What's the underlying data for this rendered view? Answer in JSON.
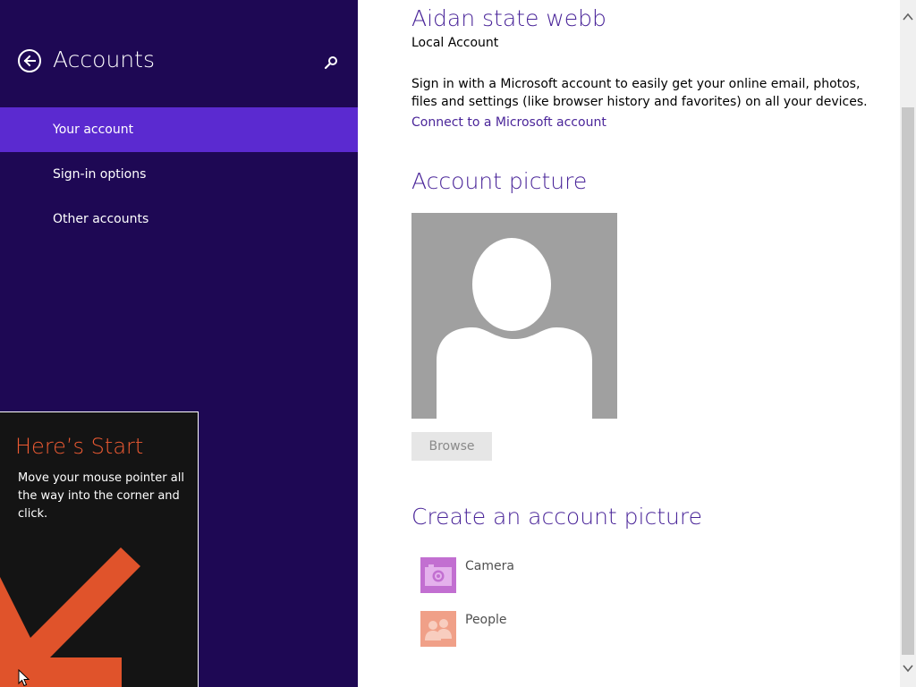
{
  "nav": {
    "title": "Accounts",
    "back_icon": "back-arrow-icon",
    "search_icon": "search-icon",
    "items": [
      {
        "label": "Your account",
        "selected": true
      },
      {
        "label": "Sign-in options",
        "selected": false
      },
      {
        "label": "Other accounts",
        "selected": false
      }
    ]
  },
  "account": {
    "name": "Aidan state webb",
    "type": "Local Account",
    "description": "Sign in with a Microsoft account to easily get your online email, photos, files and settings (like browser history and favorites) on all your devices.",
    "connect_link": "Connect to a Microsoft account"
  },
  "picture": {
    "heading": "Account picture",
    "browse_label": "Browse"
  },
  "create": {
    "heading": "Create an account picture",
    "sources": [
      {
        "label": "Camera",
        "icon": "camera-icon"
      },
      {
        "label": "People",
        "icon": "people-icon"
      }
    ]
  },
  "start_tip": {
    "title": "Here’s Start",
    "body": "Move your mouse pointer all the way into the corner and click."
  },
  "colors": {
    "nav_background": "#1e0854",
    "nav_selected": "#5b2ad0",
    "heading_accent": "#4a2599",
    "tip_title": "#ef5b33",
    "tip_arrow": "#e0532b",
    "camera_tile": "#c26fd1",
    "people_tile": "#f0a088"
  }
}
